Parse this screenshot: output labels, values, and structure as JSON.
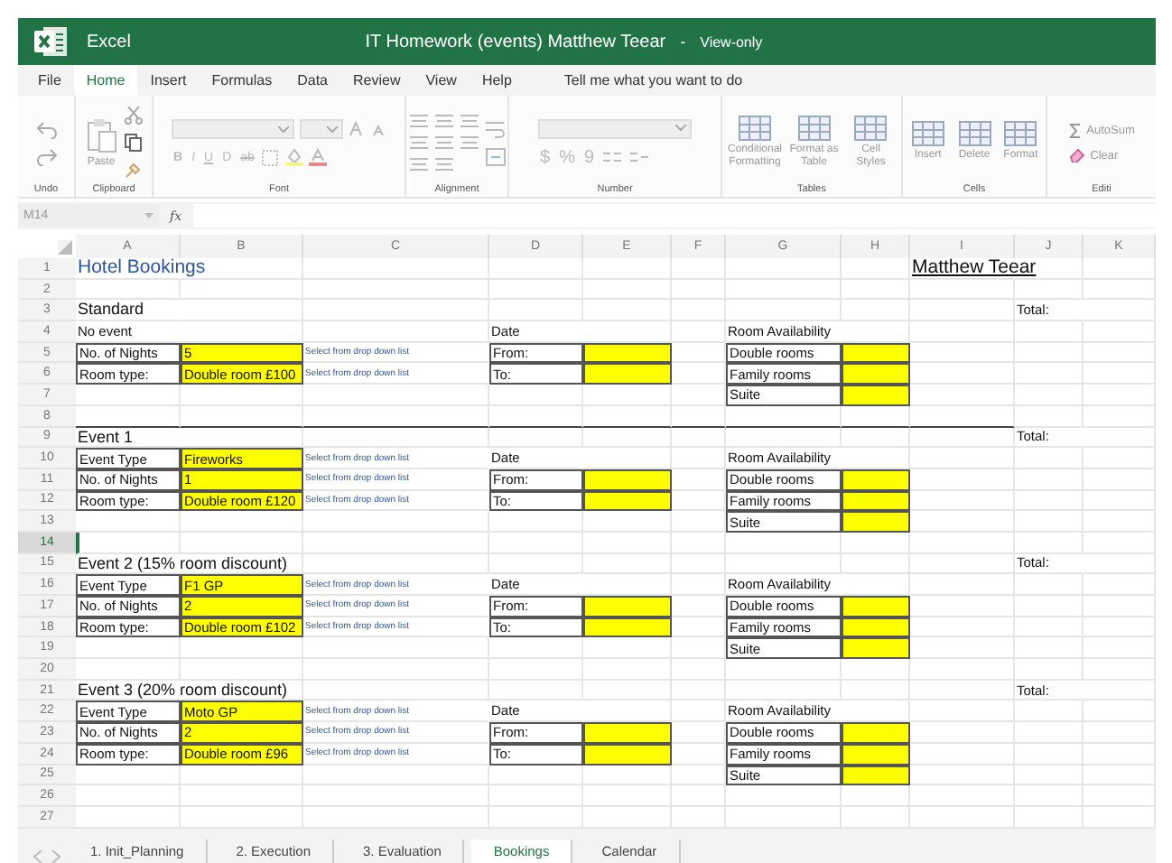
{
  "window": {
    "app": "Excel",
    "title": "IT Homework (events) Matthew Teear",
    "separator": "-",
    "mode": "View-only"
  },
  "menu": {
    "tabs": [
      {
        "label": "File",
        "selected": false
      },
      {
        "label": "Home",
        "selected": true
      },
      {
        "label": "Insert",
        "selected": false
      },
      {
        "label": "Formulas",
        "selected": false
      },
      {
        "label": "Data",
        "selected": false
      },
      {
        "label": "Review",
        "selected": false
      },
      {
        "label": "View",
        "selected": false
      },
      {
        "label": "Help",
        "selected": false
      }
    ],
    "tell_me": {
      "placeholder": "Tell me what you want to do"
    }
  },
  "ribbon": {
    "disabled": true,
    "groups": [
      {
        "kind": "undo",
        "label": "Undo"
      },
      {
        "kind": "clipboard",
        "label": "Clipboard",
        "buttons": [
          "Paste"
        ]
      },
      {
        "kind": "font",
        "label": "Font",
        "glyphs": [
          "B",
          "I",
          "U",
          "D",
          "ab"
        ]
      },
      {
        "kind": "alignment",
        "label": "Alignment"
      },
      {
        "kind": "number",
        "label": "Number",
        "glyphs": [
          "$",
          "%",
          "9"
        ]
      },
      {
        "kind": "buttons",
        "label": "Tables",
        "buttons": [
          "Conditional Formatting",
          "Format as Table",
          "Cell Styles"
        ]
      },
      {
        "kind": "buttons",
        "label": "Cells",
        "buttons": [
          "Insert",
          "Delete",
          "Format"
        ]
      },
      {
        "kind": "editing",
        "label": "Editi",
        "buttons": [
          "AutoSum",
          "Clear"
        ]
      }
    ]
  },
  "formula_bar": {
    "cell": "M14",
    "function_symbol": "fx"
  },
  "columns": [
    "A",
    "B",
    "C",
    "D",
    "E",
    "F",
    "G",
    "H",
    "I",
    "J",
    "K"
  ],
  "rows": [
    {
      "number": "1",
      "selected": false,
      "cells": [
        {
          "text": "Hotel Bookings",
          "kind": "title"
        },
        {},
        {},
        {},
        {},
        {},
        {},
        {},
        {
          "text": "Matthew Teear",
          "kind": "name"
        }
      ]
    },
    {
      "number": "2",
      "selected": false
    },
    {
      "number": "3",
      "selected": false,
      "cells": [
        {
          "text": "Standard",
          "kind": "heading"
        },
        {},
        {},
        {},
        {},
        {},
        {},
        {},
        {},
        {
          "text": "Total:",
          "kind": "plain"
        }
      ]
    },
    {
      "number": "4",
      "selected": false,
      "cells": [
        {
          "text": "No event",
          "kind": "plain"
        },
        {},
        {},
        {
          "text": "Date",
          "kind": "plain"
        },
        {},
        {},
        {
          "text": "Room Availability",
          "kind": "plain"
        }
      ]
    },
    {
      "number": "5",
      "selected": false,
      "cells": [
        {
          "text": "No. of Nights",
          "kind": "boxed"
        },
        {
          "text": "5",
          "kind": "input"
        },
        {
          "text": "Select from drop down list",
          "kind": "hint"
        },
        {
          "text": "From:",
          "kind": "boxed"
        },
        {
          "kind": "input"
        },
        {},
        {
          "text": "Double rooms",
          "kind": "boxed"
        },
        {
          "kind": "input"
        }
      ]
    },
    {
      "number": "6",
      "selected": false,
      "cells": [
        {
          "text": "Room type:",
          "kind": "boxed"
        },
        {
          "text": "Double room £100",
          "kind": "input"
        },
        {
          "text": "Select from drop down list",
          "kind": "hint"
        },
        {
          "text": "To:",
          "kind": "boxed"
        },
        {
          "kind": "input"
        },
        {},
        {
          "text": "Family rooms",
          "kind": "boxed"
        },
        {
          "kind": "input"
        }
      ]
    },
    {
      "number": "7",
      "selected": false,
      "cells": [
        {},
        {},
        {},
        {},
        {},
        {},
        {
          "text": "Suite",
          "kind": "boxed"
        },
        {
          "kind": "input"
        }
      ]
    },
    {
      "number": "8",
      "selected": false,
      "rule": true
    },
    {
      "number": "9",
      "selected": false,
      "cells": [
        {
          "text": "Event 1",
          "kind": "heading"
        },
        {},
        {},
        {},
        {},
        {},
        {},
        {},
        {},
        {
          "text": "Total:",
          "kind": "plain"
        }
      ]
    },
    {
      "number": "10",
      "selected": false,
      "cells": [
        {
          "text": "Event Type",
          "kind": "boxed"
        },
        {
          "text": "Fireworks",
          "kind": "input"
        },
        {
          "text": "Select from drop down list",
          "kind": "hint"
        },
        {
          "text": "Date",
          "kind": "plain"
        },
        {},
        {},
        {
          "text": "Room Availability",
          "kind": "plain"
        }
      ]
    },
    {
      "number": "11",
      "selected": false,
      "cells": [
        {
          "text": "No. of Nights",
          "kind": "boxed"
        },
        {
          "text": "1",
          "kind": "input"
        },
        {
          "text": "Select from drop down list",
          "kind": "hint"
        },
        {
          "text": "From:",
          "kind": "boxed"
        },
        {
          "kind": "input"
        },
        {},
        {
          "text": "Double rooms",
          "kind": "boxed"
        },
        {
          "kind": "input"
        }
      ]
    },
    {
      "number": "12",
      "selected": false,
      "cells": [
        {
          "text": "Room type:",
          "kind": "boxed"
        },
        {
          "text": "Double room £120",
          "kind": "input"
        },
        {
          "text": "Select from drop down list",
          "kind": "hint"
        },
        {
          "text": "To:",
          "kind": "boxed"
        },
        {
          "kind": "input"
        },
        {},
        {
          "text": "Family rooms",
          "kind": "boxed"
        },
        {
          "kind": "input"
        }
      ]
    },
    {
      "number": "13",
      "selected": false,
      "cells": [
        {},
        {},
        {},
        {},
        {},
        {},
        {
          "text": "Suite",
          "kind": "boxed"
        },
        {
          "kind": "input"
        }
      ]
    },
    {
      "number": "14",
      "selected": true
    },
    {
      "number": "15",
      "selected": false,
      "cells": [
        {
          "text": "Event 2 (15% room discount)",
          "kind": "heading"
        },
        {},
        {},
        {},
        {},
        {},
        {},
        {},
        {},
        {
          "text": "Total:",
          "kind": "plain"
        }
      ]
    },
    {
      "number": "16",
      "selected": false,
      "cells": [
        {
          "text": "Event Type",
          "kind": "boxed"
        },
        {
          "text": "F1 GP",
          "kind": "input"
        },
        {
          "text": "Select from drop down list",
          "kind": "hint"
        },
        {
          "text": "Date",
          "kind": "plain"
        },
        {},
        {},
        {
          "text": "Room Availability",
          "kind": "plain"
        }
      ]
    },
    {
      "number": "17",
      "selected": false,
      "cells": [
        {
          "text": "No. of Nights",
          "kind": "boxed"
        },
        {
          "text": "2",
          "kind": "input"
        },
        {
          "text": "Select from drop down list",
          "kind": "hint"
        },
        {
          "text": "From:",
          "kind": "boxed"
        },
        {
          "kind": "input"
        },
        {},
        {
          "text": "Double rooms",
          "kind": "boxed"
        },
        {
          "kind": "input"
        }
      ]
    },
    {
      "number": "18",
      "selected": false,
      "cells": [
        {
          "text": "Room type:",
          "kind": "boxed"
        },
        {
          "text": "Double room £102",
          "kind": "input"
        },
        {
          "text": "Select from drop down list",
          "kind": "hint"
        },
        {
          "text": "To:",
          "kind": "boxed"
        },
        {
          "kind": "input"
        },
        {},
        {
          "text": "Family rooms",
          "kind": "boxed"
        },
        {
          "kind": "input"
        }
      ]
    },
    {
      "number": "19",
      "selected": false,
      "cells": [
        {},
        {},
        {},
        {},
        {},
        {},
        {
          "text": "Suite",
          "kind": "boxed"
        },
        {
          "kind": "input"
        }
      ]
    },
    {
      "number": "20",
      "selected": false
    },
    {
      "number": "21",
      "selected": false,
      "cells": [
        {
          "text": "Event 3 (20% room discount)",
          "kind": "heading"
        },
        {},
        {},
        {},
        {},
        {},
        {},
        {},
        {},
        {
          "text": "Total:",
          "kind": "plain"
        }
      ]
    },
    {
      "number": "22",
      "selected": false,
      "cells": [
        {
          "text": "Event Type",
          "kind": "boxed"
        },
        {
          "text": "Moto GP",
          "kind": "input"
        },
        {
          "text": "Select from drop down list",
          "kind": "hint"
        },
        {
          "text": "Date",
          "kind": "plain"
        },
        {},
        {},
        {
          "text": "Room Availability",
          "kind": "plain"
        }
      ]
    },
    {
      "number": "23",
      "selected": false,
      "cells": [
        {
          "text": "No. of Nights",
          "kind": "boxed"
        },
        {
          "text": "2",
          "kind": "input"
        },
        {
          "text": "Select from drop down list",
          "kind": "hint"
        },
        {
          "text": "From:",
          "kind": "boxed"
        },
        {
          "kind": "input"
        },
        {},
        {
          "text": "Double rooms",
          "kind": "boxed"
        },
        {
          "kind": "input"
        }
      ]
    },
    {
      "number": "24",
      "selected": false,
      "cells": [
        {
          "text": "Room type:",
          "kind": "boxed"
        },
        {
          "text": "Double room £96",
          "kind": "input"
        },
        {
          "text": "Select from drop down list",
          "kind": "hint"
        },
        {
          "text": "To:",
          "kind": "boxed"
        },
        {
          "kind": "input"
        },
        {},
        {
          "text": "Family rooms",
          "kind": "boxed"
        },
        {
          "kind": "input"
        }
      ]
    },
    {
      "number": "25",
      "selected": false,
      "cells": [
        {},
        {},
        {},
        {},
        {},
        {},
        {
          "text": "Suite",
          "kind": "boxed"
        },
        {
          "kind": "input"
        }
      ]
    },
    {
      "number": "26",
      "selected": false
    },
    {
      "number": "27",
      "selected": false
    }
  ],
  "sheet_tabs": [
    {
      "label": "1. Init_Planning",
      "selected": false
    },
    {
      "label": "2. Execution",
      "selected": false
    },
    {
      "label": "3. Evaluation",
      "selected": false
    },
    {
      "label": "Bookings",
      "selected": true
    },
    {
      "label": "Calendar",
      "selected": false
    }
  ]
}
